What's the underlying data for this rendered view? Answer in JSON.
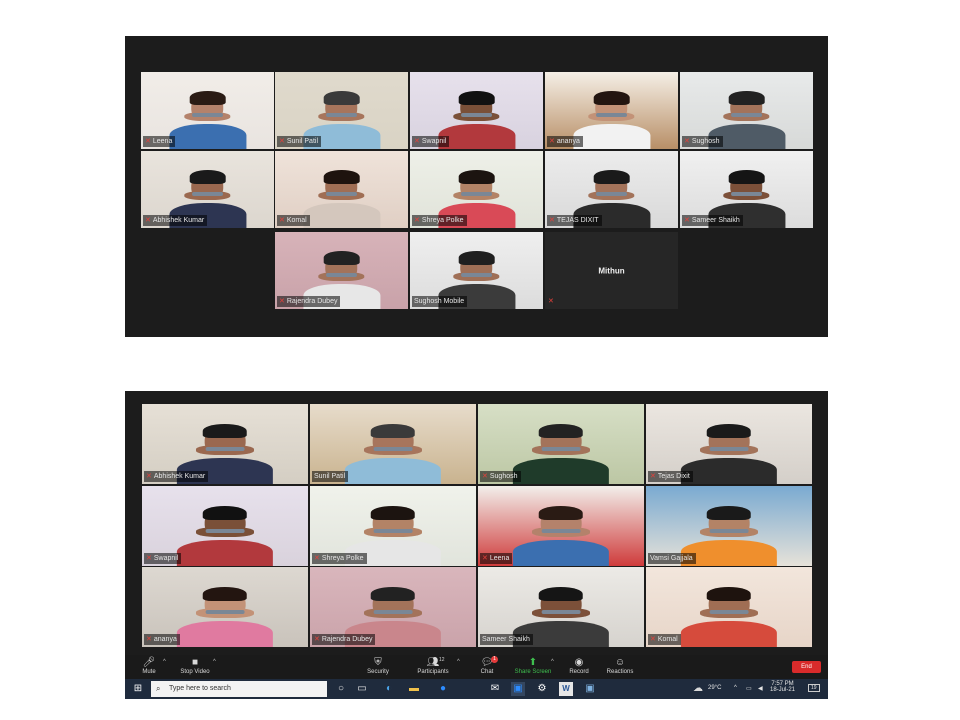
{
  "meeting_top": {
    "tiles": [
      {
        "name": "Leena",
        "muted": true,
        "bg": "#e9e4e0",
        "skin": "#b4826b",
        "hair": "#2a1b14",
        "shirt": "#3b6fb0",
        "active": false,
        "wall": "#f1ede8"
      },
      {
        "name": "Sunil Patil",
        "muted": true,
        "bg": "#d9d3c4",
        "skin": "#a7755c",
        "hair": "#3a3a3a",
        "shirt": "#8fbcd8",
        "active": true,
        "wall": "#e0dacd"
      },
      {
        "name": "Swapnil",
        "muted": true,
        "bg": "#d8d2df",
        "skin": "#7a5038",
        "hair": "#111111",
        "shirt": "#b2393d",
        "active": false,
        "wall": "#e7e1ec"
      },
      {
        "name": "ananya",
        "muted": true,
        "bg": "#b88f67",
        "skin": "#c39277",
        "hair": "#231510",
        "shirt": "#f2f2f2",
        "active": false,
        "wall": "#f5efe6"
      },
      {
        "name": "Sughosh",
        "muted": true,
        "bg": "#d7d9d8",
        "skin": "#a3735a",
        "hair": "#222222",
        "shirt": "#4f5b66",
        "active": false,
        "wall": "#e8eaea"
      },
      {
        "name": "Abhishek Kumar",
        "muted": true,
        "bg": "#dcd6ce",
        "skin": "#9a684f",
        "hair": "#1a1a1a",
        "shirt": "#2d3552",
        "active": false,
        "wall": "#e9e4dd"
      },
      {
        "name": "Komal",
        "muted": true,
        "bg": "#e0cfc4",
        "skin": "#a06e54",
        "hair": "#1e130e",
        "shirt": "#d4c7bd",
        "active": false,
        "wall": "#efe3da"
      },
      {
        "name": "Shreya Polke",
        "muted": true,
        "bg": "#e0e3d9",
        "skin": "#b38366",
        "hair": "#1c1410",
        "shirt": "#d94a57",
        "active": false,
        "wall": "#eef0e8"
      },
      {
        "name": "TEJAS DIXIT",
        "muted": true,
        "bg": "#d9d9d9",
        "skin": "#a3735a",
        "hair": "#1a1a1a",
        "shirt": "#2b2b2b",
        "active": false,
        "wall": "#ececec"
      },
      {
        "name": "Sameer Shaikh",
        "muted": true,
        "bg": "#dcdcdc",
        "skin": "#7c5039",
        "hair": "#151515",
        "shirt": "#2f2f2f",
        "active": false,
        "wall": "#f0f0f0"
      },
      {
        "name": "Rajendra Dubey",
        "muted": true,
        "bg": "#c9a2a9",
        "skin": "#a3735a",
        "hair": "#222222",
        "shirt": "#e7e7e7",
        "active": false,
        "wall": "#d7b3b9"
      },
      {
        "name": "Sughosh Mobile",
        "muted": false,
        "bg": "#dcdcdc",
        "skin": "#9f6f56",
        "hair": "#1f1f1f",
        "shirt": "#3b3b3b",
        "active": false,
        "wall": "#efefef"
      },
      {
        "name": "Mithun",
        "muted": true,
        "video_off": true,
        "active": false
      }
    ]
  },
  "meeting_bottom": {
    "tiles": [
      {
        "name": "Abhishek Kumar",
        "muted": true,
        "bg": "#d4cec3",
        "skin": "#9a684f",
        "hair": "#1a1a1a",
        "shirt": "#2d3552",
        "active": false,
        "wall": "#e6e0d6"
      },
      {
        "name": "Sunil Patil",
        "muted": false,
        "bg": "#c9b38f",
        "skin": "#a7755c",
        "hair": "#3a3a3a",
        "shirt": "#8fbcd8",
        "active": false,
        "wall": "#e7dccb"
      },
      {
        "name": "Sughosh",
        "muted": true,
        "bg": "#bcc7a4",
        "skin": "#a3735a",
        "hair": "#222222",
        "shirt": "#1f3b2a",
        "active": false,
        "wall": "#d7dfc6"
      },
      {
        "name": "Tejas Dixit",
        "muted": true,
        "bg": "#d4cfc9",
        "skin": "#a3735a",
        "hair": "#1a1a1a",
        "shirt": "#2b2b2b",
        "active": false,
        "wall": "#ebe6e0"
      },
      {
        "name": "Swapnil",
        "muted": true,
        "bg": "#d9d2dc",
        "skin": "#7a5038",
        "hair": "#111111",
        "shirt": "#b2393d",
        "active": false,
        "wall": "#e7e1ec"
      },
      {
        "name": "Shreya Polke",
        "muted": true,
        "bg": "#e1e4dc",
        "skin": "#b38366",
        "hair": "#1c1410",
        "shirt": "#e6e6e6",
        "active": false,
        "wall": "#f0f2eb"
      },
      {
        "name": "Leena",
        "muted": true,
        "bg": "#cf3b3b",
        "skin": "#b4826b",
        "hair": "#2a1b14",
        "shirt": "#3b6fb0",
        "active": false,
        "wall": "#f2efeb"
      },
      {
        "name": "Vamsi Gajjala",
        "muted": false,
        "bg": "#e6e2d9",
        "skin": "#b38366",
        "hair": "#1a1a1a",
        "shirt": "#ef8f2d",
        "active": true,
        "wall": "#7aaad1"
      },
      {
        "name": "ananya",
        "muted": true,
        "bg": "#c9c3bb",
        "skin": "#c39277",
        "hair": "#231510",
        "shirt": "#e07aa0",
        "active": false,
        "wall": "#ddd8d1"
      },
      {
        "name": "Rajendra Dubey",
        "muted": true,
        "bg": "#caa3aa",
        "skin": "#a3735a",
        "hair": "#222222",
        "shirt": "#c9868c",
        "active": false,
        "wall": "#d9b6bc"
      },
      {
        "name": "Sameer Shaikh",
        "muted": false,
        "bg": "#d6d3ce",
        "skin": "#7c5039",
        "hair": "#151515",
        "shirt": "#3b3b3b",
        "active": false,
        "wall": "#eceae6"
      },
      {
        "name": "Komal",
        "muted": true,
        "bg": "#e7d5c8",
        "skin": "#a06e54",
        "hair": "#1e130e",
        "shirt": "#d64b3c",
        "active": false,
        "wall": "#f2e6dc"
      }
    ],
    "toolbar": {
      "mute": "Mute",
      "stop_video": "Stop Video",
      "security": "Security",
      "participants": "Participants",
      "participants_count": "12",
      "chat": "Chat",
      "chat_badge": "1",
      "share_screen": "Share Screen",
      "record": "Record",
      "reactions": "Reactions",
      "end": "End"
    },
    "taskbar": {
      "search_placeholder": "Type here to search",
      "temperature": "29°C",
      "time": "7:57 PM",
      "date": "18-Jul-21",
      "notification_count": "19"
    }
  }
}
